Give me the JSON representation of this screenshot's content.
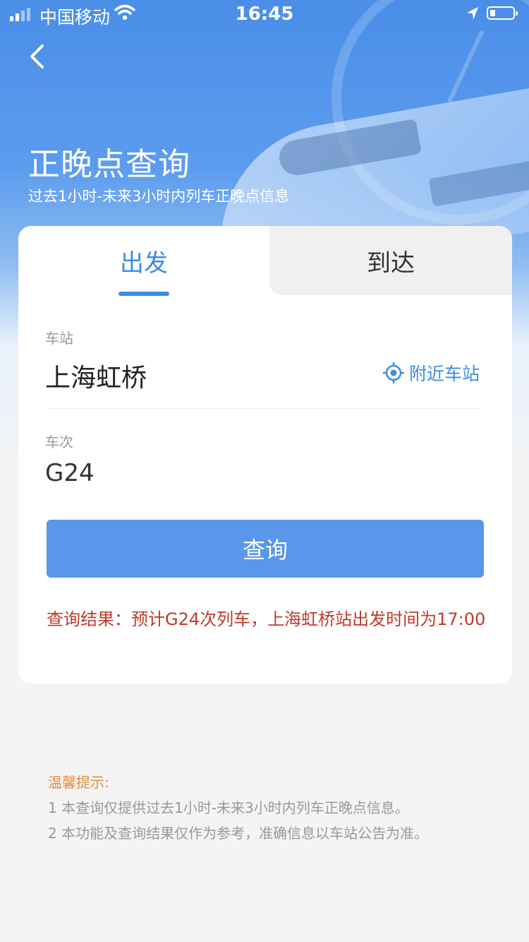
{
  "status_bar": {
    "carrier": "中国移动",
    "time": "16:45"
  },
  "header": {
    "title": "正晚点查询",
    "subtitle": "过去1小时-未来3小时内列车正晚点信息"
  },
  "tabs": {
    "depart": "出发",
    "arrive": "到达",
    "active": "depart"
  },
  "form": {
    "station_label": "车站",
    "station_value": "上海虹桥",
    "nearby_label": "附近车站",
    "train_label": "车次",
    "train_value": "G24",
    "query_button": "查询"
  },
  "result": {
    "text": "查询结果：预计G24次列车，上海虹桥站出发时间为17:00"
  },
  "tips": {
    "title": "温馨提示:",
    "items": [
      "1 本查询仅提供过去1小时-未来3小时内列车正晚点信息。",
      "2 本功能及查询结果仅作为参考，准确信息以车站公告为准。"
    ]
  },
  "colors": {
    "accent": "#3d8ce8",
    "button": "#5a97ea",
    "result": "#c0392b",
    "tips_title": "#e58b3b"
  }
}
